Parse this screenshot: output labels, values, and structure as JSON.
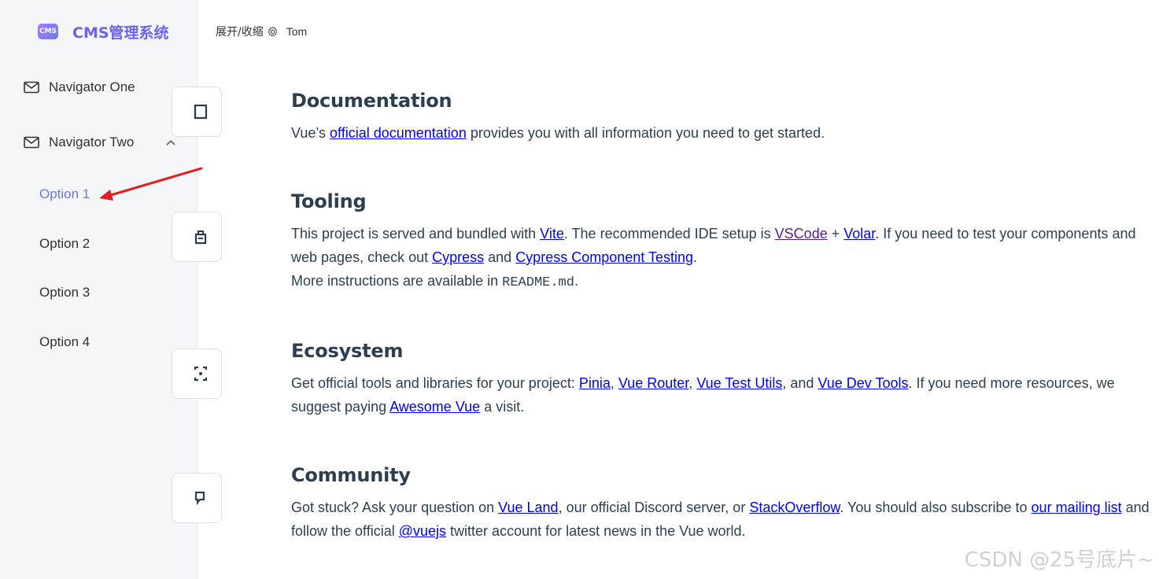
{
  "app": {
    "logo_badge": "CMS",
    "logo_title": "CMS管理系统"
  },
  "sidebar": {
    "items": [
      {
        "label": "Navigator One",
        "icon": "mail-icon"
      },
      {
        "label": "Navigator Two",
        "icon": "mail-icon",
        "expanded": true
      }
    ],
    "sub_items": [
      "Option 1",
      "Option 2",
      "Option 3",
      "Option 4"
    ],
    "active_sub_item": "Option 1"
  },
  "header": {
    "collapse_label": "展开/收缩",
    "user_name": "Tom"
  },
  "content": {
    "documentation": {
      "title": "Documentation",
      "t1": "Vue’s ",
      "link_docs": "official documentation",
      "t2": " provides you with all information you need to get started."
    },
    "tooling": {
      "title": "Tooling",
      "t1": "This project is served and bundled with ",
      "link_vite": "Vite",
      "t2": ". The recommended IDE setup is ",
      "link_vscode": "VSCode",
      "t3": " + ",
      "link_volar": "Volar",
      "t4": ". If you need to test your components and web pages, check out ",
      "link_cypress": "Cypress",
      "t5": " and ",
      "link_cypress_ct": "Cypress Component Testing",
      "t6": ".",
      "t7": "More instructions are available in ",
      "readme": "README.md",
      "t8": "."
    },
    "ecosystem": {
      "title": "Ecosystem",
      "t1": "Get official tools and libraries for your project: ",
      "link_pinia": "Pinia",
      "t2": ", ",
      "link_router": "Vue Router",
      "t3": ", ",
      "link_test_utils": "Vue Test Utils",
      "t4": ", and ",
      "link_devtools": "Vue Dev Tools",
      "t5": ". If you need more resources, we suggest paying ",
      "link_awesome": "Awesome Vue",
      "t6": " a visit."
    },
    "community": {
      "title": "Community",
      "t1": "Got stuck? Ask your question on ",
      "link_vueland": "Vue Land",
      "t2": ", our official Discord server, or ",
      "link_so": "StackOverflow",
      "t3": ". You should also subscribe to ",
      "link_mailing": "our mailing list",
      "t4": " and follow the official ",
      "link_vuejs": "@vuejs",
      "t5": " twitter account for latest news in the Vue world."
    }
  },
  "watermark": "CSDN @25号底片~",
  "colors": {
    "sidebar_bg": "#f5f6fa",
    "accent": "#6c63e8",
    "active_item": "#6c7bd8",
    "link": "#0000ee",
    "text": "#2c3e50",
    "annotation_arrow": "#e02020"
  }
}
